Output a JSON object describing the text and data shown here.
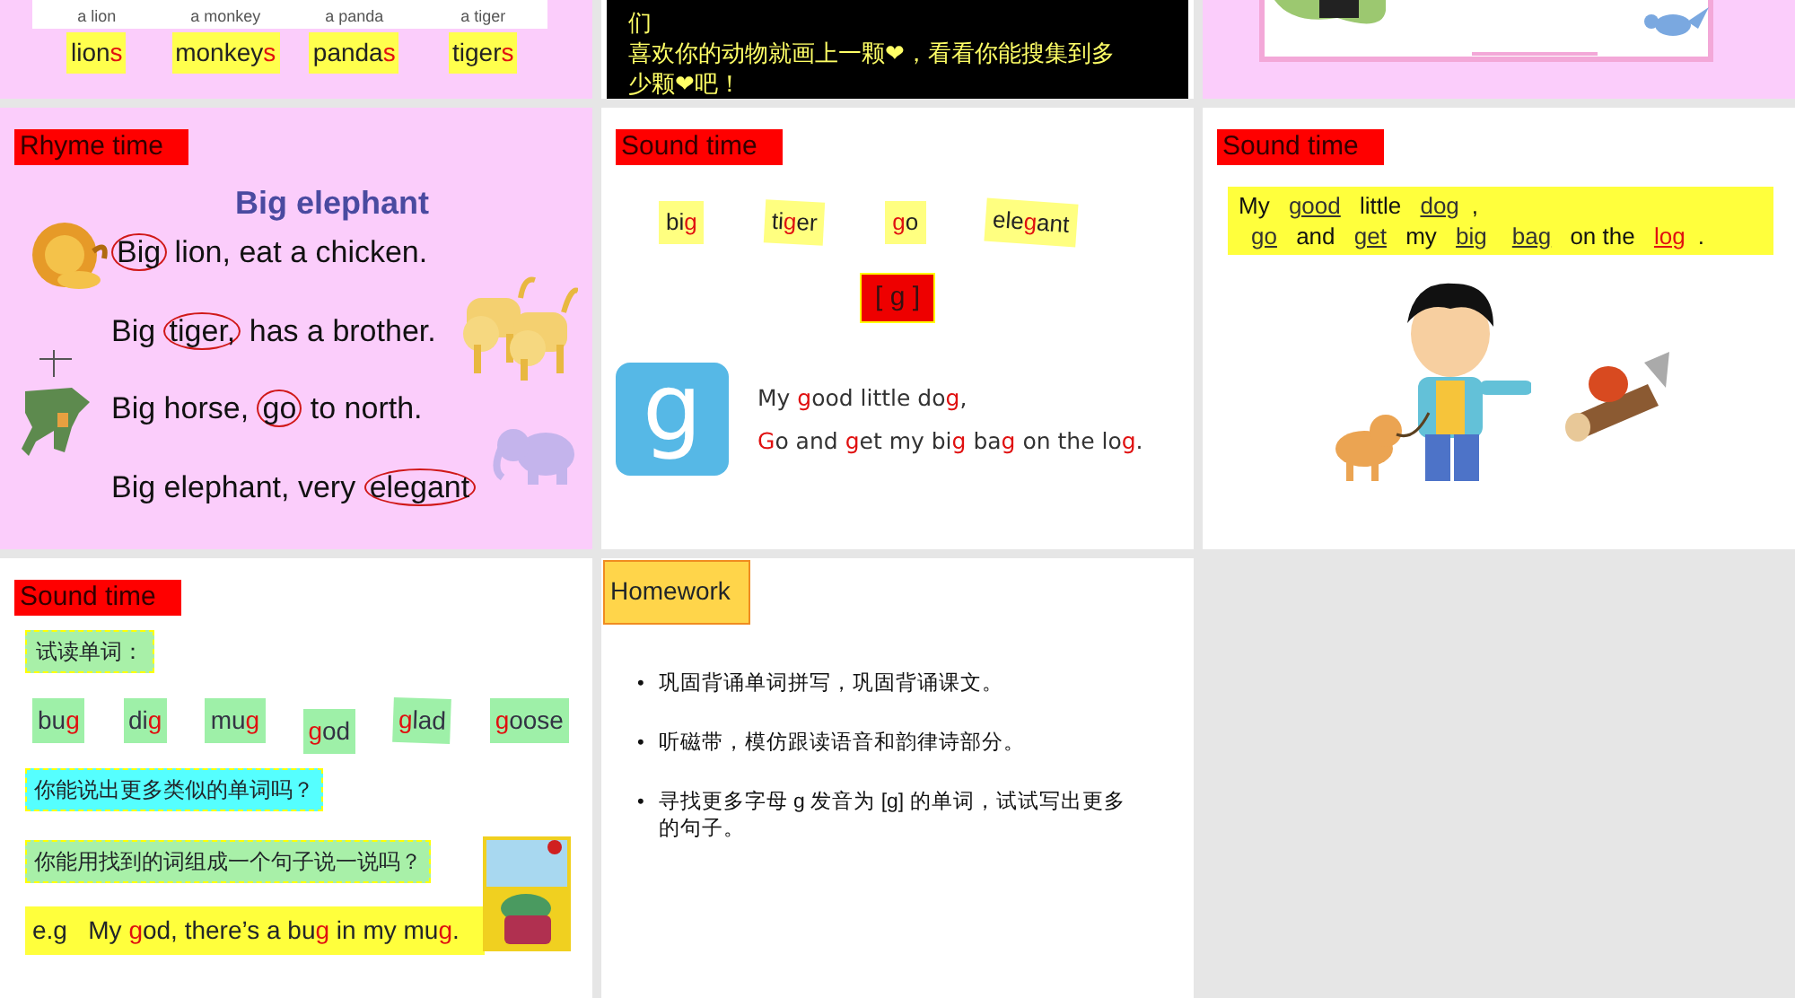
{
  "slides": [
    {
      "kind": "vocab",
      "words": [
        {
          "caption": "a lion",
          "parts": [
            {
              "text": "lion",
              "red": false
            },
            {
              "text": "s",
              "red": true
            }
          ]
        },
        {
          "caption": "a monkey",
          "parts": [
            {
              "text": "monkey",
              "red": false
            },
            {
              "text": "s",
              "red": true
            }
          ]
        },
        {
          "caption": "a panda",
          "parts": [
            {
              "text": "panda",
              "red": false
            },
            {
              "text": "s",
              "red": true
            }
          ]
        },
        {
          "caption": "a tiger",
          "parts": [
            {
              "text": "tiger",
              "red": false
            },
            {
              "text": "s",
              "red": true
            }
          ]
        }
      ]
    },
    {
      "kind": "notice",
      "lines": [
        "们",
        "喜欢你的动物就画上一颗❤，看看你能搜集到多",
        "少颗❤吧！"
      ]
    },
    {
      "kind": "scene"
    },
    {
      "kind": "rhyme",
      "tag": "Rhyme time",
      "title": "Big elephant",
      "lines": [
        [
          {
            "text": "Big",
            "circled": true
          },
          {
            "text": " lion, eat a chicken.",
            "circled": false
          }
        ],
        [
          {
            "text": "Big ",
            "circled": false
          },
          {
            "text": "tiger,",
            "circled": true
          },
          {
            "text": " has a brother.",
            "circled": false
          }
        ],
        [
          {
            "text": "Big horse, ",
            "circled": false
          },
          {
            "text": "go",
            "circled": true
          },
          {
            "text": " to north.",
            "circled": false
          }
        ],
        [
          {
            "text": "Big elephant, very ",
            "circled": false
          },
          {
            "text": "elegant",
            "circled": true
          }
        ]
      ]
    },
    {
      "kind": "sound",
      "tag": "Sound time",
      "words": [
        [
          {
            "text": "bi",
            "red": false
          },
          {
            "text": "g",
            "red": true
          }
        ],
        [
          {
            "text": "ti",
            "red": false
          },
          {
            "text": "g",
            "red": true
          },
          {
            "text": "er",
            "red": false
          }
        ],
        [
          {
            "text": "g",
            "red": true
          },
          {
            "text": "o",
            "red": false
          }
        ],
        [
          {
            "text": "ele",
            "red": false
          },
          {
            "text": "g",
            "red": true
          },
          {
            "text": "ant",
            "red": false
          }
        ]
      ],
      "phoneme": "[ g ]",
      "letter": "g",
      "lines": [
        [
          {
            "text": "My ",
            "red": false
          },
          {
            "text": "g",
            "red": true
          },
          {
            "text": "ood little do",
            "red": false
          },
          {
            "text": "g",
            "red": true
          },
          {
            "text": ",",
            "red": false
          }
        ],
        [
          {
            "text": "G",
            "red": true
          },
          {
            "text": "o and ",
            "red": false
          },
          {
            "text": "g",
            "red": true
          },
          {
            "text": "et my bi",
            "red": false
          },
          {
            "text": "g",
            "red": true
          },
          {
            "text": " ba",
            "red": false
          },
          {
            "text": "g",
            "red": true
          },
          {
            "text": " on the lo",
            "red": false
          },
          {
            "text": "g",
            "red": true
          },
          {
            "text": ".",
            "red": false
          }
        ]
      ]
    },
    {
      "kind": "fill",
      "tag": "Sound time",
      "lines": [
        [
          {
            "text": "My ",
            "blank": false,
            "red": false
          },
          {
            "text": "good",
            "blank": true,
            "red": false
          },
          {
            "text": " little ",
            "blank": false,
            "red": false
          },
          {
            "text": "dog",
            "blank": true,
            "red": false
          },
          {
            "text": ",",
            "blank": false,
            "red": false
          }
        ],
        [
          {
            "text": "go",
            "blank": true,
            "red": false
          },
          {
            "text": " and ",
            "blank": false,
            "red": false
          },
          {
            "text": "get",
            "blank": true,
            "red": false
          },
          {
            "text": " my ",
            "blank": false,
            "red": false
          },
          {
            "text": "big",
            "blank": true,
            "red": false
          },
          {
            "text": "bag",
            "blank": true,
            "red": false
          },
          {
            "text": " on the ",
            "blank": false,
            "red": false
          },
          {
            "text": "log",
            "blank": true,
            "red": true
          },
          {
            "text": ".",
            "blank": false,
            "red": false
          }
        ]
      ]
    },
    {
      "kind": "practice",
      "tag": "Sound time",
      "prompt": "试读单词：",
      "words": [
        [
          {
            "text": "bu",
            "red": false
          },
          {
            "text": "g",
            "red": true
          }
        ],
        [
          {
            "text": "di",
            "red": false
          },
          {
            "text": "g",
            "red": true
          }
        ],
        [
          {
            "text": "mu",
            "red": false
          },
          {
            "text": "g",
            "red": true
          }
        ],
        [
          {
            "text": "g",
            "red": true
          },
          {
            "text": "od",
            "red": false
          }
        ],
        [
          {
            "text": "g",
            "red": true
          },
          {
            "text": "lad",
            "red": false
          }
        ],
        [
          {
            "text": "g",
            "red": true
          },
          {
            "text": "oose",
            "red": false
          }
        ]
      ],
      "questions": [
        "你能说出更多类似的单词吗？",
        "你能用找到的词组成一个句子说一说吗？"
      ],
      "example": [
        {
          "text": "e.g   My ",
          "red": false
        },
        {
          "text": "g",
          "red": true
        },
        {
          "text": "od, there’s a bu",
          "red": false
        },
        {
          "text": "g",
          "red": true
        },
        {
          "text": " in my mu",
          "red": false
        },
        {
          "text": "g",
          "red": true
        },
        {
          "text": ".",
          "red": false
        }
      ]
    },
    {
      "kind": "homework",
      "tag": "Homework",
      "bullet": "•",
      "items": [
        "巩固背诵单词拼写，巩固背诵课文。",
        "听磁带，模仿跟读语音和韵律诗部分。",
        "寻找更多字母 g 发音为 [g]  的单词，试试写出更多的句子。"
      ]
    }
  ]
}
